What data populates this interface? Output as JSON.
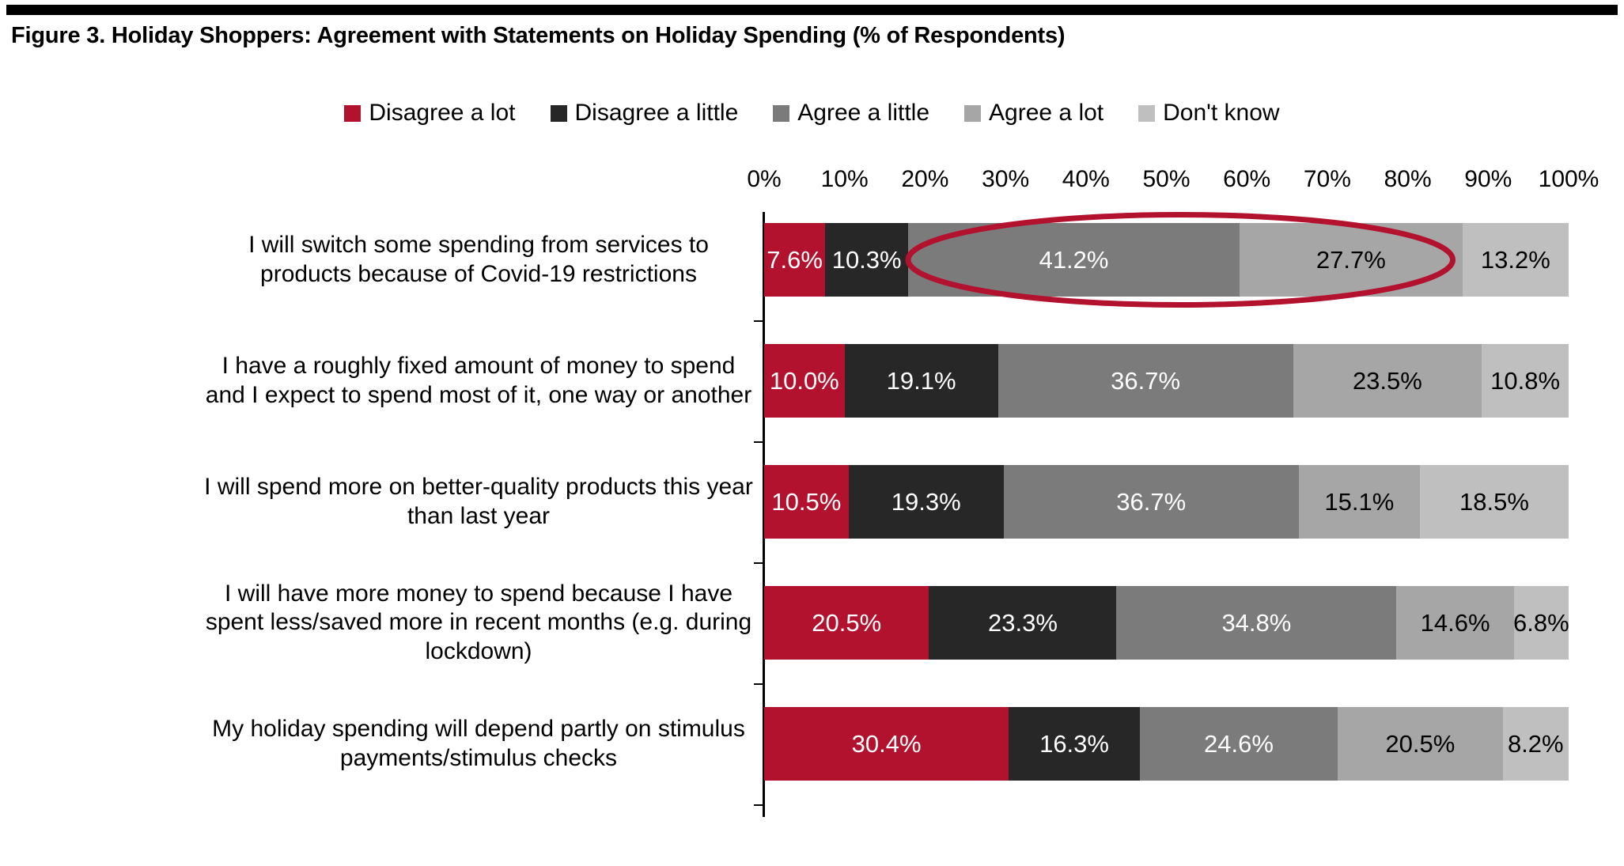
{
  "figure": {
    "title": "Figure 3. Holiday Shoppers: Agreement with Statements on Holiday Spending (% of Respondents)"
  },
  "colors": {
    "disagree_a_lot": "#B3122F",
    "disagree_a_little": "#272727",
    "agree_a_little": "#7B7B7B",
    "agree_a_lot": "#A6A6A6",
    "dont_know": "#BFBFBF",
    "highlight": "#B3122F",
    "axis": "#000000"
  },
  "legend": {
    "items": [
      {
        "label": "Disagree a lot",
        "color": "#B3122F"
      },
      {
        "label": "Disagree a little",
        "color": "#272727"
      },
      {
        "label": "Agree a little",
        "color": "#7B7B7B"
      },
      {
        "label": "Agree a lot",
        "color": "#A6A6A6"
      },
      {
        "label": "Don't know",
        "color": "#BFBFBF"
      }
    ]
  },
  "axis": {
    "ticks": [
      "0%",
      "10%",
      "20%",
      "30%",
      "40%",
      "50%",
      "60%",
      "70%",
      "80%",
      "90%",
      "100%"
    ]
  },
  "annotation": {
    "ellipse_target": "Agree a little + Agree a lot of row 1"
  },
  "chart_data": {
    "type": "bar",
    "orientation": "horizontal",
    "stacked": true,
    "stacked_mode": "percent",
    "title": "Figure 3. Holiday Shoppers: Agreement with Statements on Holiday Spending (% of Respondents)",
    "xlabel": "",
    "ylabel": "",
    "xlim": [
      0,
      100
    ],
    "xticks": [
      0,
      10,
      20,
      30,
      40,
      50,
      60,
      70,
      80,
      90,
      100
    ],
    "xtick_labels": [
      "0%",
      "10%",
      "20%",
      "30%",
      "40%",
      "50%",
      "60%",
      "70%",
      "80%",
      "90%",
      "100%"
    ],
    "grid": false,
    "legend_position": "top-center",
    "categories": [
      "I will switch some spending from services to products because of Covid-19 restrictions",
      "I have a roughly fixed amount of money to spend and I expect to spend most of it, one way or another",
      "I will spend more on better-quality products this year than last year",
      "I will have more money to spend because I have spent less/saved more in recent months (e.g. during lockdown)",
      "My holiday spending will depend partly on stimulus payments/stimulus checks"
    ],
    "series": [
      {
        "name": "Disagree a lot",
        "color": "#B3122F",
        "values": [
          7.6,
          10.0,
          10.5,
          20.5,
          30.4
        ]
      },
      {
        "name": "Disagree a little",
        "color": "#272727",
        "values": [
          10.3,
          19.1,
          19.3,
          23.3,
          16.3
        ]
      },
      {
        "name": "Agree a little",
        "color": "#7B7B7B",
        "values": [
          41.2,
          36.7,
          36.7,
          34.8,
          24.6
        ]
      },
      {
        "name": "Agree a lot",
        "color": "#A6A6A6",
        "values": [
          27.7,
          23.5,
          15.1,
          14.6,
          20.5
        ]
      },
      {
        "name": "Don't know",
        "color": "#BFBFBF",
        "values": [
          13.2,
          10.8,
          18.5,
          6.8,
          8.2
        ]
      }
    ],
    "data_labels": [
      [
        "7.6%",
        "10.3%",
        "41.2%",
        "27.7%",
        "13.2%"
      ],
      [
        "10.0%",
        "19.1%",
        "36.7%",
        "23.5%",
        "10.8%"
      ],
      [
        "10.5%",
        "19.3%",
        "36.7%",
        "15.1%",
        "18.5%"
      ],
      [
        "20.5%",
        "23.3%",
        "34.8%",
        "14.6%",
        "6.8%"
      ],
      [
        "30.4%",
        "16.3%",
        "24.6%",
        "20.5%",
        "8.2%"
      ]
    ],
    "annotations": [
      {
        "type": "ellipse",
        "row": 0,
        "from_pct": 17.9,
        "to_pct": 85.6,
        "color": "#B3122F"
      }
    ]
  }
}
